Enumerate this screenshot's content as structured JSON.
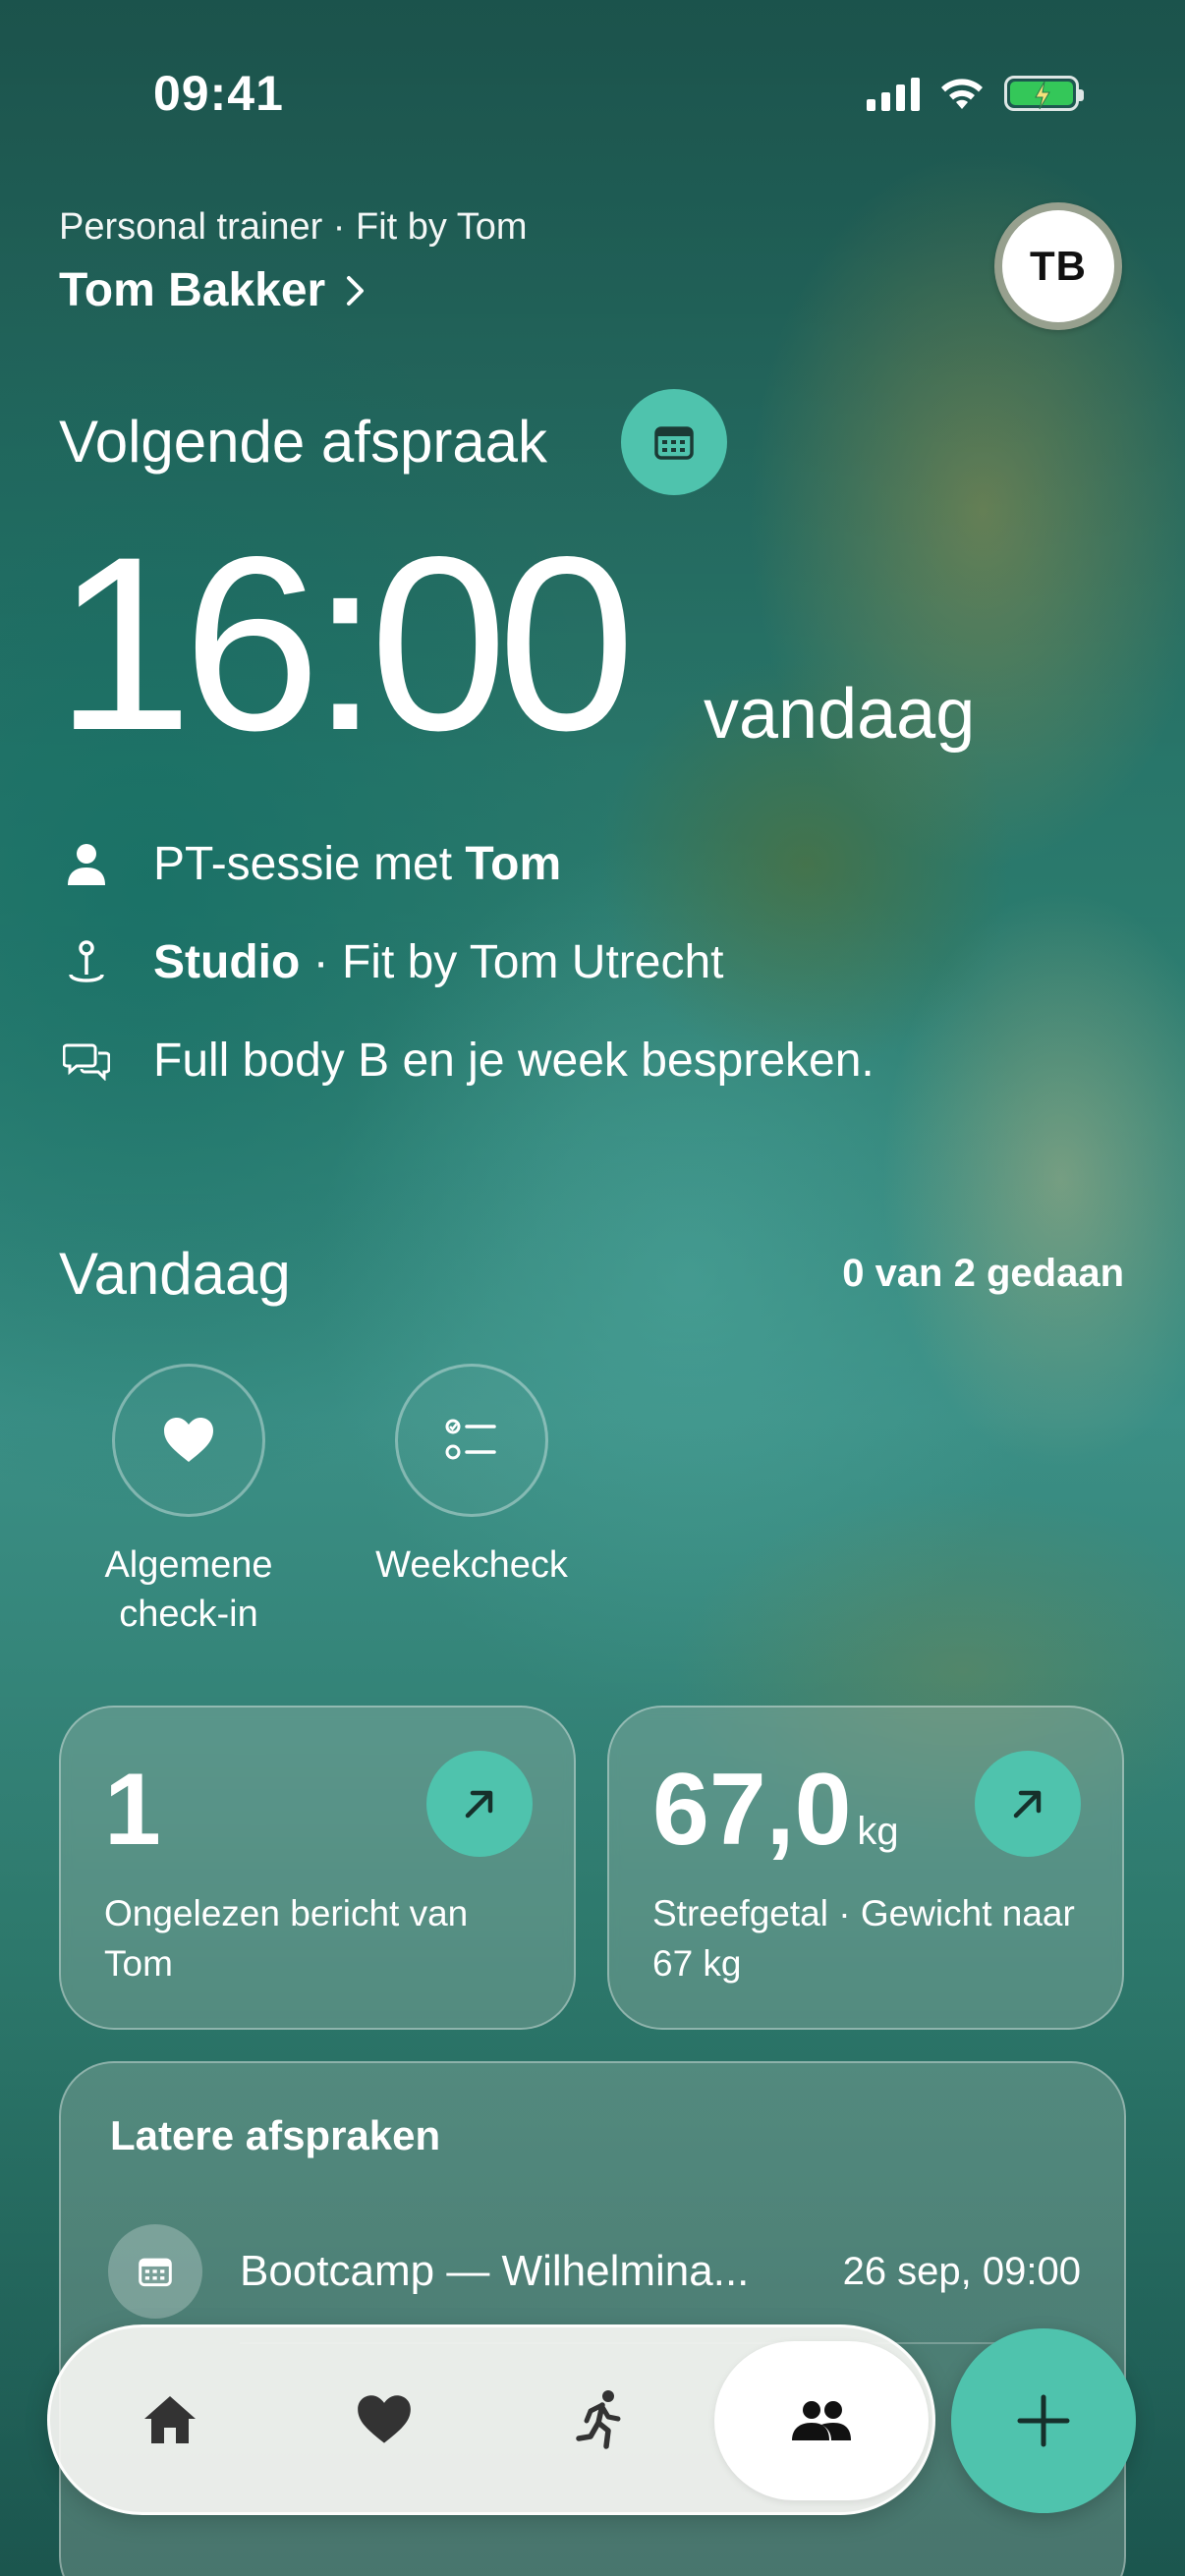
{
  "status_bar": {
    "time": "09:41"
  },
  "header": {
    "subtitle": "Personal trainer · Fit by Tom",
    "name": "Tom Bakker",
    "avatar_initials": "TB"
  },
  "next_appointment": {
    "title": "Volgende afspraak",
    "time": "16:00",
    "day": "vandaag",
    "session_prefix": "PT-sessie met ",
    "session_trainer": "Tom",
    "location_name": "Studio",
    "location_rest": " · Fit by Tom Utrecht",
    "note": "Full body B en je week bespreken."
  },
  "today": {
    "title": "Vandaag",
    "progress": "0 van 2 gedaan",
    "tasks": [
      {
        "label_line1": "Algemene",
        "label_line2": "check-in",
        "icon": "heart-icon"
      },
      {
        "label_line1": "Weekcheck",
        "label_line2": "",
        "icon": "checklist-icon"
      }
    ]
  },
  "cards": {
    "messages": {
      "value": "1",
      "desc": "Ongelezen bericht van Tom"
    },
    "goal": {
      "value": "67,0",
      "unit": "kg",
      "desc": "Streefgetal · Gewicht naar 67 kg"
    }
  },
  "later": {
    "title": "Latere afspraken",
    "items": [
      {
        "title": "Bootcamp — Wilhelmina...",
        "date": "26 sep, 09:00"
      }
    ]
  },
  "tabbar": {
    "tabs": [
      "home-icon",
      "heart-icon",
      "running-icon",
      "people-icon"
    ],
    "active": "people-icon"
  },
  "colors": {
    "accent": "#4fc3ad",
    "battery": "#34c759"
  }
}
